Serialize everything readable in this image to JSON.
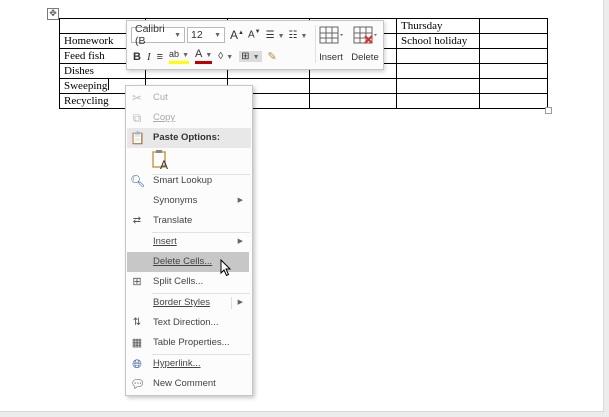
{
  "table": {
    "rows": [
      [
        "",
        "",
        "",
        "",
        "Thursday",
        ""
      ],
      [
        "Homework",
        "",
        "",
        "",
        "School holiday",
        ""
      ],
      [
        "Feed fish",
        "",
        "",
        "",
        "",
        ""
      ],
      [
        "Dishes",
        "",
        "",
        "",
        "",
        ""
      ],
      [
        "Sweeping",
        "",
        "",
        "",
        "",
        ""
      ],
      [
        "Recycling",
        "",
        "",
        "",
        "",
        ""
      ]
    ]
  },
  "mini_toolbar": {
    "font_name": "Calibri (B",
    "font_size": "12",
    "grow_font": "A",
    "shrink_font": "A",
    "bold": "B",
    "italic": "I",
    "font_color_letter": "A",
    "insert_label": "Insert",
    "delete_label": "Delete"
  },
  "context_menu": {
    "cut": "Cut",
    "copy": "Copy",
    "paste_options": "Paste Options:",
    "paste_keep_text": "A",
    "smart_lookup": "Smart Lookup",
    "synonyms": "Synonyms",
    "translate": "Translate",
    "insert": "Insert",
    "delete_cells": "Delete Cells...",
    "split_cells": "Split Cells...",
    "border_styles": "Border Styles",
    "text_direction": "Text Direction...",
    "table_properties": "Table Properties...",
    "hyperlink": "Hyperlink...",
    "new_comment": "New Comment"
  },
  "colors": {
    "highlight": "#ffff00",
    "font_color": "#c00000",
    "menu_hover": "#c7c7c7"
  }
}
